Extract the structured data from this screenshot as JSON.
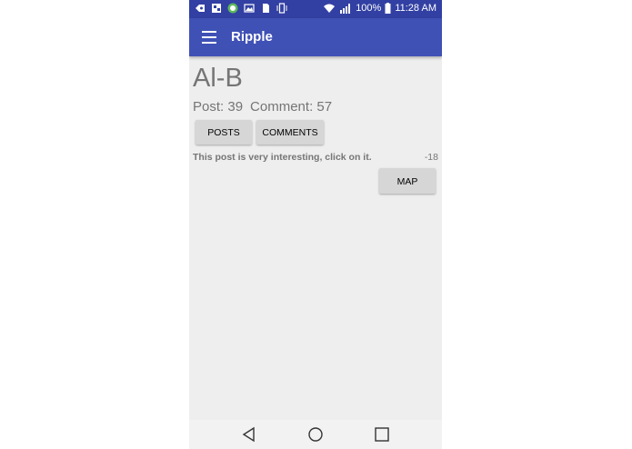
{
  "status_bar": {
    "battery": "100%",
    "time": "11:28 AM",
    "left_icons": [
      "notification-icon",
      "gallery-icon",
      "app-icon",
      "image-icon",
      "sim-icon",
      "vibrate-icon"
    ],
    "right_icons": [
      "wifi-icon",
      "signal-icon",
      "battery-icon"
    ]
  },
  "app_bar": {
    "title": "Ripple",
    "menu_icon": "hamburger-menu-icon"
  },
  "profile": {
    "name": "Al-B",
    "post_label": "Post: 39",
    "comment_label": "Comment: 57"
  },
  "buttons": {
    "posts": "POSTS",
    "comments": "COMMENTS",
    "map": "MAP"
  },
  "post": {
    "text": "This post is very interesting, click on it.",
    "score": "-18"
  },
  "nav_bar": {
    "icons": [
      "back-icon",
      "home-icon",
      "recent-apps-icon"
    ]
  },
  "colors": {
    "app_bar": "#3f51b5",
    "status_bar": "#3240a3",
    "background": "#eeeeee",
    "button": "#d6d6d6",
    "text_gray": "#757575"
  }
}
